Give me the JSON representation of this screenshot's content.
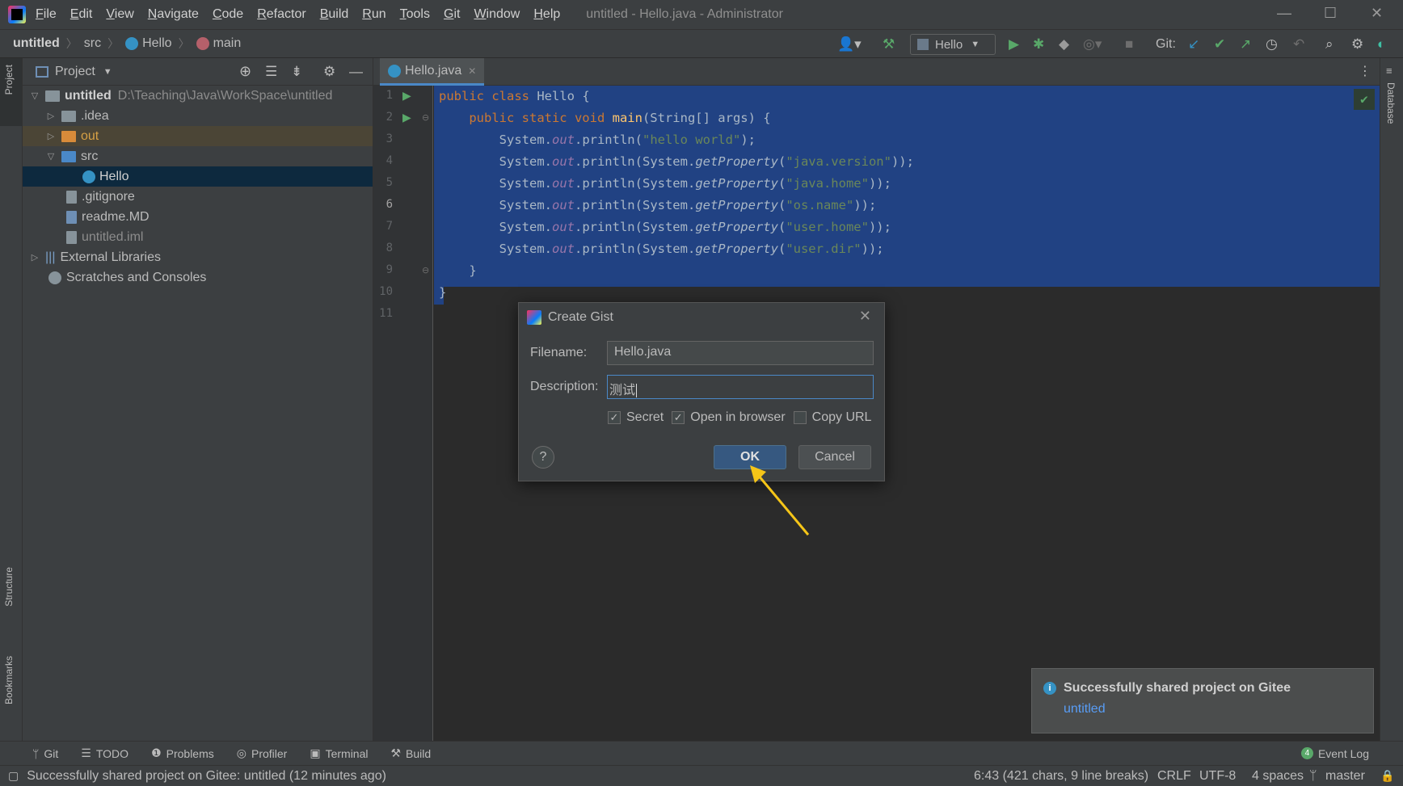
{
  "titlebar": {
    "menus": [
      "File",
      "Edit",
      "View",
      "Navigate",
      "Code",
      "Refactor",
      "Build",
      "Run",
      "Tools",
      "Git",
      "Window",
      "Help"
    ],
    "window_title": "untitled - Hello.java - Administrator"
  },
  "navbar": {
    "crumbs": [
      "untitled",
      "src",
      "Hello",
      "main"
    ],
    "run_config": "Hello",
    "git_label": "Git:"
  },
  "left_strip": {
    "project": "Project",
    "structure": "Structure",
    "bookmarks": "Bookmarks"
  },
  "right_strip": {
    "database": "Database"
  },
  "project_panel": {
    "title": "Project",
    "tree": {
      "root": "untitled",
      "root_path": "D:\\Teaching\\Java\\WorkSpace\\untitled",
      "idea": ".idea",
      "out": "out",
      "src": "src",
      "hello": "Hello",
      "gitignore": ".gitignore",
      "readme": "readme.MD",
      "iml": "untitled.iml",
      "external": "External Libraries",
      "scratches": "Scratches and Consoles"
    }
  },
  "editor": {
    "tab": "Hello.java",
    "line_numbers": [
      "1",
      "2",
      "3",
      "4",
      "5",
      "6",
      "7",
      "8",
      "9",
      "10",
      "11"
    ],
    "code": {
      "l1_kw": "public class ",
      "l1_name": "Hello {",
      "l2_kw": "    public static void ",
      "l2_m": "main",
      "l2_rest": "(String[] args) {",
      "sys": "        System.",
      "out": "out",
      "println": ".println(",
      "sysprop": "System.",
      "getprop": "getProperty",
      "l3_str": "\"hello world\"",
      "l4_str": "\"java.version\"",
      "l5_str": "\"java.home\"",
      "l6_str": "\"os.name\"",
      "l7_str": "\"user.home\"",
      "l8_str": "\"user.dir\"",
      "close1": ");",
      "close2": "));",
      "l9": "    }",
      "l10": "}"
    }
  },
  "dialog": {
    "title": "Create Gist",
    "filename_label": "Filename:",
    "filename_value": "Hello.java",
    "description_label": "Description:",
    "description_value": "测试",
    "secret": {
      "label": "Secret",
      "checked": true
    },
    "open_in_browser": {
      "label": "Open in browser",
      "checked": true
    },
    "copy_url": {
      "label": "Copy URL",
      "checked": false
    },
    "help": "?",
    "ok": "OK",
    "cancel": "Cancel"
  },
  "notification": {
    "title": "Successfully shared project on Gitee",
    "link": "untitled"
  },
  "bottom_tabs": [
    "Git",
    "TODO",
    "Problems",
    "Profiler",
    "Terminal",
    "Build"
  ],
  "event_log": {
    "count": "4",
    "label": "Event Log"
  },
  "statusbar": {
    "message": "Successfully shared project on Gitee: untitled (12 minutes ago)",
    "position": "6:43 (421 chars, 9 line breaks)",
    "line_sep": "CRLF",
    "encoding": "UTF-8",
    "indent": "4 spaces",
    "branch": "master"
  },
  "colors": {
    "accent": "#4a88c7",
    "selection": "#214283",
    "arrow": "#f5c518",
    "ok_button": "#365880"
  }
}
